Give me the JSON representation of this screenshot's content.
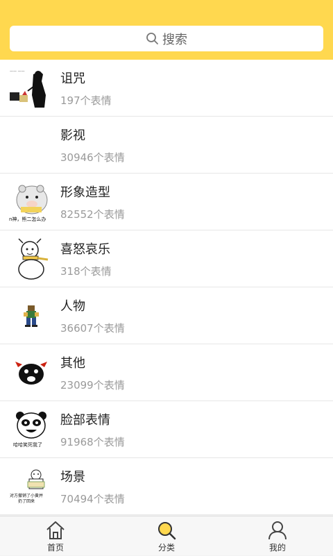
{
  "search": {
    "icon": "search-icon",
    "label": "搜索"
  },
  "categories": [
    {
      "title": "诅咒",
      "count": "197",
      "suffix": "个表情",
      "thumb": "curse-figure"
    },
    {
      "title": "影视",
      "count": "30946",
      "suffix": "个表情",
      "thumb": "blank"
    },
    {
      "title": "形象造型",
      "count": "82552",
      "suffix": "个表情",
      "thumb": "hamster-character"
    },
    {
      "title": "喜怒哀乐",
      "count": "318",
      "suffix": "个表情",
      "thumb": "snowman-character"
    },
    {
      "title": "人物",
      "count": "36607",
      "suffix": "个表情",
      "thumb": "pixel-figure"
    },
    {
      "title": "其他",
      "count": "23099",
      "suffix": "个表情",
      "thumb": "black-devil-face"
    },
    {
      "title": "脸部表情",
      "count": "91968",
      "suffix": "个表情",
      "thumb": "panda-face"
    },
    {
      "title": "场景",
      "count": "70494",
      "suffix": "个表情",
      "thumb": "bear-sign"
    }
  ],
  "thumb_captions": {
    "hamster": "n神，熊二怎么办",
    "panda": "哈哈笑死我了",
    "bear": "对方撤销了小黄并扔了回来"
  },
  "tabs": [
    {
      "label": "首页",
      "icon": "home-icon",
      "active": false
    },
    {
      "label": "分类",
      "icon": "search-icon",
      "active": true
    },
    {
      "label": "我的",
      "icon": "user-icon",
      "active": false
    }
  ],
  "colors": {
    "header": "#ffd84f",
    "search_bg": "#ffffff",
    "divider": "#e6e6e6",
    "count_text": "#9a9a9a",
    "active_icon": "#ffd84f"
  }
}
